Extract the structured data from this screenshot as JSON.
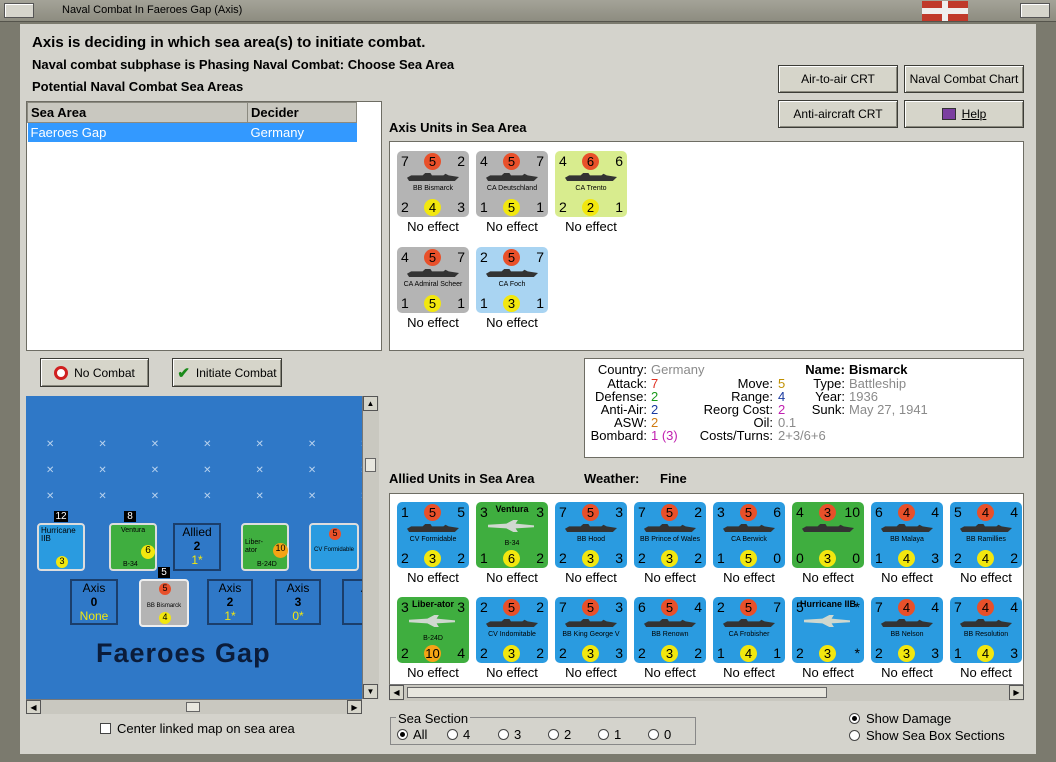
{
  "window": {
    "title": "Naval Combat In Faeroes Gap (Axis)"
  },
  "headers": {
    "main": "Axis is deciding in which sea area(s) to initiate combat.",
    "subphase": "Naval combat subphase is Phasing Naval Combat: Choose Sea Area",
    "potential": "Potential Naval Combat Sea Areas"
  },
  "buttons": {
    "air_to_air": "Air-to-air CRT",
    "naval_chart": "Naval Combat Chart",
    "anti_aircraft": "Anti-aircraft CRT",
    "help": "Help",
    "no_combat": "No Combat",
    "initiate_combat": "Initiate Combat"
  },
  "sea_table": {
    "headers": [
      "Sea Area",
      "Decider"
    ],
    "rows": [
      {
        "area": "Faeroes Gap",
        "decider": "Germany"
      }
    ]
  },
  "axis_label": "Axis Units in Sea Area",
  "axis_units": [
    {
      "tl": "7",
      "tc": "5",
      "tr": "2",
      "bl": "2",
      "bc": "4",
      "br": "3",
      "name": "BB Bismarck",
      "bg": "#b4b4b4",
      "effect": "No effect"
    },
    {
      "tl": "4",
      "tc": "5",
      "tr": "7",
      "bl": "1",
      "bc": "5",
      "br": "1",
      "name": "CA Deutschland",
      "bg": "#b4b4b4",
      "effect": "No effect"
    },
    {
      "tl": "4",
      "tc": "6",
      "tr": "6",
      "bl": "2",
      "bc": "2",
      "br": "1",
      "name": "CA Trento",
      "bg": "#d8ec8e",
      "effect": "No effect"
    },
    {
      "tl": "4",
      "tc": "5",
      "tr": "7",
      "bl": "1",
      "bc": "5",
      "br": "1",
      "name": "CA Admiral Scheer",
      "bg": "#b4b4b4",
      "effect": "No effect"
    },
    {
      "tl": "2",
      "tc": "5",
      "tr": "7",
      "bl": "1",
      "bc": "3",
      "br": "1",
      "name": "CA Foch",
      "bg": "#a9d4f2",
      "effect": "No effect"
    }
  ],
  "details": {
    "country_k": "Country:",
    "country": "Germany",
    "attack_k": "Attack:",
    "attack": "7",
    "defense_k": "Defense:",
    "defense": "2",
    "antiair_k": "Anti-Air:",
    "antiair": "2",
    "asw_k": "ASW:",
    "asw": "2",
    "bombard_k": "Bombard:",
    "bombard": "1 (3)",
    "move_k": "Move:",
    "move": "5",
    "range_k": "Range:",
    "range": "4",
    "reorg_k": "Reorg Cost:",
    "reorg": "2",
    "oil_k": "Oil:",
    "oil": "0.1",
    "costs_k": "Costs/Turns:",
    "costs": "2+3/6+6",
    "name_k": "Name:",
    "name": "Bismarck",
    "type_k": "Type:",
    "type": "Battleship",
    "year_k": "Year:",
    "year": "1936",
    "sunk_k": "Sunk:",
    "sunk": "May 27, 1941"
  },
  "allied_label": "Allied Units in Sea Area",
  "weather": {
    "label": "Weather:",
    "value": "Fine"
  },
  "allied_units": [
    {
      "tl": "1",
      "tc": "5",
      "tr": "5",
      "bl": "2",
      "bc": "3",
      "br": "2",
      "name": "CV Formidable",
      "bg": "#2a9be0",
      "effect": "No effect",
      "kind": "ship"
    },
    {
      "tl": "3",
      "tc": "",
      "tr": "3",
      "bl": "1",
      "bc": "6",
      "br": "2",
      "name": "B-34",
      "title": "Ventura",
      "bg": "#3fae3f",
      "effect": "No effect",
      "kind": "air"
    },
    {
      "tl": "7",
      "tc": "5",
      "tr": "3",
      "bl": "2",
      "bc": "3",
      "br": "3",
      "name": "BB Hood",
      "bg": "#2a9be0",
      "effect": "No effect",
      "kind": "ship"
    },
    {
      "tl": "7",
      "tc": "5",
      "tr": "2",
      "bl": "2",
      "bc": "3",
      "br": "2",
      "name": "BB Prince of Wales",
      "bg": "#2a9be0",
      "effect": "No effect",
      "kind": "ship"
    },
    {
      "tl": "3",
      "tc": "5",
      "tr": "6",
      "bl": "1",
      "bc": "5",
      "br": "0",
      "name": "CA Berwick",
      "bg": "#2a9be0",
      "effect": "No effect",
      "kind": "ship"
    },
    {
      "tl": "4",
      "tc": "3",
      "tr": "10",
      "bl": "0",
      "bc": "3",
      "br": "0",
      "name": "",
      "bg": "#3fae3f",
      "effect": "No effect",
      "kind": "ship"
    },
    {
      "tl": "6",
      "tc": "4",
      "tr": "4",
      "bl": "1",
      "bc": "4",
      "br": "3",
      "name": "BB Malaya",
      "bg": "#2a9be0",
      "effect": "No effect",
      "kind": "ship"
    },
    {
      "tl": "5",
      "tc": "4",
      "tr": "4",
      "bl": "2",
      "bc": "4",
      "br": "2",
      "name": "BB Ramillies",
      "bg": "#2a9be0",
      "effect": "No effect",
      "kind": "ship"
    },
    {
      "tl": "3",
      "tc": "",
      "tr": "3",
      "bl": "2",
      "bc": "10",
      "br": "4",
      "name": "B-24D",
      "title": "Liber-ator",
      "bg": "#3fae3f",
      "effect": "No effect",
      "kind": "air"
    },
    {
      "tl": "2",
      "tc": "5",
      "tr": "2",
      "bl": "2",
      "bc": "3",
      "br": "2",
      "name": "CV Indomitable",
      "bg": "#2a9be0",
      "effect": "No effect",
      "kind": "ship"
    },
    {
      "tl": "7",
      "tc": "5",
      "tr": "3",
      "bl": "2",
      "bc": "3",
      "br": "3",
      "name": "BB King George V",
      "bg": "#2a9be0",
      "effect": "No effect",
      "kind": "ship"
    },
    {
      "tl": "6",
      "tc": "5",
      "tr": "4",
      "bl": "2",
      "bc": "3",
      "br": "2",
      "name": "BB Renown",
      "bg": "#2a9be0",
      "effect": "No effect",
      "kind": "ship"
    },
    {
      "tl": "2",
      "tc": "5",
      "tr": "7",
      "bl": "1",
      "bc": "4",
      "br": "1",
      "name": "CA Frobisher",
      "bg": "#2a9be0",
      "effect": "No effect",
      "kind": "ship"
    },
    {
      "tl": "5",
      "tc": "",
      "tr": "*",
      "bl": "2",
      "bc": "3",
      "br": "*",
      "name": "",
      "title": "Hurricane IIB",
      "bg": "#2a9be0",
      "effect": "No effect",
      "kind": "air"
    },
    {
      "tl": "7",
      "tc": "4",
      "tr": "4",
      "bl": "2",
      "bc": "3",
      "br": "3",
      "name": "BB Nelson",
      "bg": "#2a9be0",
      "effect": "No effect",
      "kind": "ship"
    },
    {
      "tl": "7",
      "tc": "4",
      "tr": "4",
      "bl": "1",
      "bc": "4",
      "br": "3",
      "name": "BB Resolution",
      "bg": "#2a9be0",
      "effect": "No effect",
      "kind": "ship"
    }
  ],
  "map": {
    "sea_name": "Faeroes Gap",
    "allied_box": {
      "label": "Allied",
      "value": "2",
      "sub": "1*"
    },
    "axis_boxes": [
      {
        "label": "Axis",
        "value": "0",
        "sub": "None"
      },
      {
        "label": "Axis",
        "value": "2",
        "sub": "1*"
      },
      {
        "label": "Axis",
        "value": "3",
        "sub": "0*"
      },
      {
        "label": "A",
        "value": "",
        "sub": ""
      }
    ],
    "stack_counts": [
      "12",
      "8",
      "5"
    ],
    "counter_labels": [
      "Hurricane IIB",
      "Ventura",
      "B-34",
      "Liber-ator",
      "B-24D",
      "CV Formidable",
      "BB Bismarck"
    ]
  },
  "center_linked": "Center linked map on sea area",
  "sea_section": {
    "label": "Sea Section",
    "options": [
      "All",
      "4",
      "3",
      "2",
      "1",
      "0"
    ],
    "selected": "All"
  },
  "show": {
    "damage": "Show Damage",
    "sections": "Show Sea Box Sections",
    "selected": "damage"
  },
  "colors": {
    "attack": "#e8502a",
    "defense": "#f2e70f",
    "selection": "#3399ff",
    "sea": "#2f78c7"
  }
}
